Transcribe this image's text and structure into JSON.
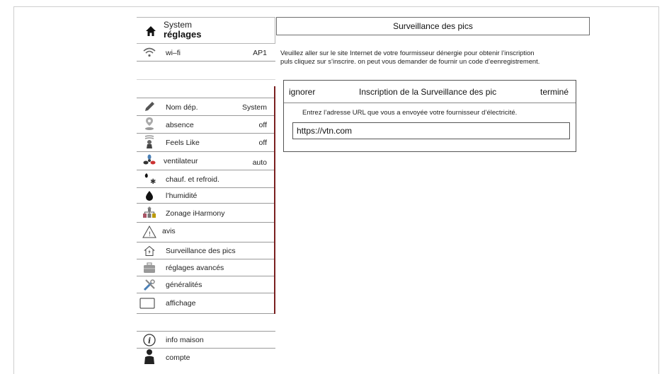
{
  "sidebar": {
    "header": {
      "line1": "System",
      "line2": "réglages"
    },
    "items": [
      {
        "label": "wi–fi",
        "value": "AP1",
        "icon": "wifi-icon"
      },
      {
        "label": "",
        "value": "",
        "icon": ""
      },
      {
        "label": "Nom dép.",
        "value": "System",
        "icon": "pencil-icon"
      },
      {
        "label": "absence",
        "value": "off",
        "icon": "location-pin-icon"
      },
      {
        "label": "Feels Like",
        "value": "off",
        "icon": "person-temperature-icon"
      },
      {
        "label": "ventilateur",
        "value": "auto",
        "icon": "fan-icon"
      },
      {
        "label": "chauf. et refroid.",
        "value": "",
        "icon": "heat-cool-icon"
      },
      {
        "label": "l’humidité",
        "value": "",
        "icon": "water-drop-icon"
      },
      {
        "label": "Zonage iHarmony",
        "value": "",
        "icon": "zoning-icon"
      },
      {
        "label": "avis",
        "value": "",
        "icon": "warning-triangle-icon"
      },
      {
        "label": "Surveillance des pics",
        "value": "",
        "icon": "house-bolt-icon"
      },
      {
        "label": "réglages avancés",
        "value": "",
        "icon": "toolbox-icon"
      },
      {
        "label": "généralités",
        "value": "",
        "icon": "tools-icon"
      },
      {
        "label": "affichage",
        "value": "",
        "icon": "display-icon"
      },
      {
        "label": "",
        "value": "",
        "icon": ""
      },
      {
        "label": "info maison",
        "value": "",
        "icon": "info-icon"
      },
      {
        "label": "compte",
        "value": "",
        "icon": "user-icon"
      }
    ]
  },
  "main": {
    "title": "Surveillance des pics",
    "intro_line1": "Veuillez aller sur le site Internet de votre fourmisseur dénergie pour obtenir l’inscription",
    "intro_line2": "puls cliquez sur s’inscrire. on peut vous demander de fournir un code d’eenregistrement.",
    "card": {
      "ignore_label": "ignorer",
      "title": "Inscription de la Surveillance des pic",
      "done_label": "terminé",
      "description": "Entrez l’adresse URL que vous a envoyée votre fournisseur d’électricité.",
      "url_value": "https://vtn.com"
    }
  },
  "colors": {
    "accent_bar": "#7a1f1f",
    "border": "#9a9a9a"
  }
}
